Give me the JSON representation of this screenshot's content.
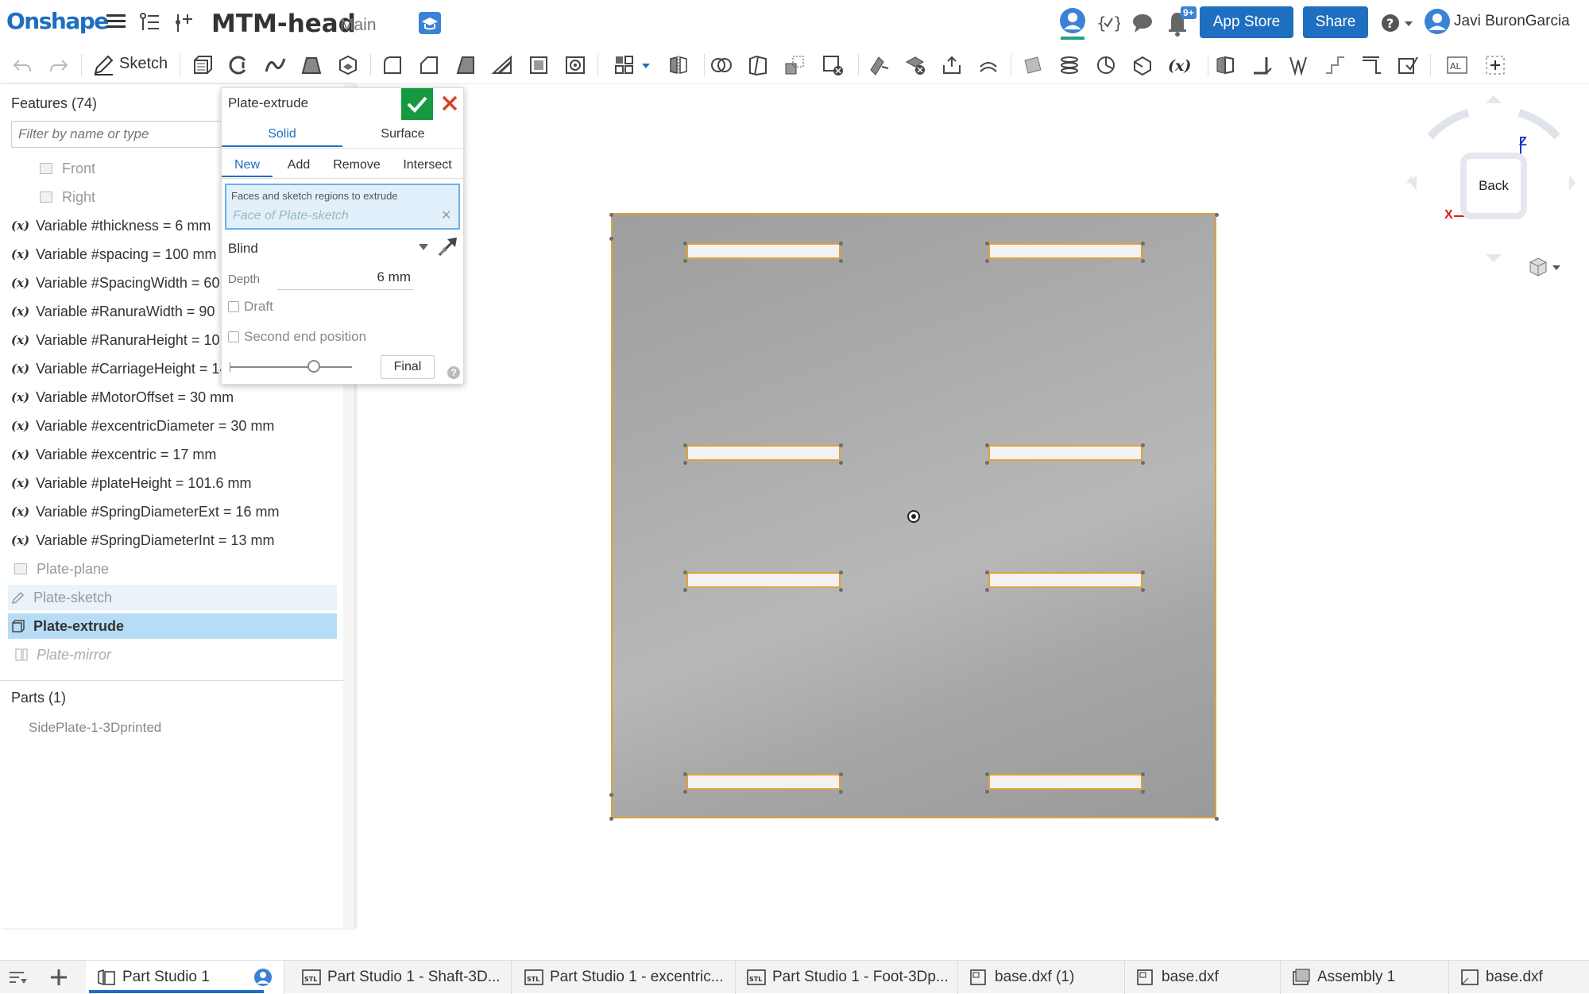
{
  "app": {
    "logo": "Onshape",
    "doc_title": "MTM-head",
    "branch": "Main",
    "app_store": "App Store",
    "share": "Share",
    "user_name": "Javi BuronGarcia",
    "notifications_badge": "9+"
  },
  "toolbar": {
    "sketch_label": "Sketch"
  },
  "features": {
    "header": "Features (74)",
    "filter_placeholder": "Filter by name or type",
    "items": [
      {
        "label": "Front",
        "type": "plane"
      },
      {
        "label": "Right",
        "type": "plane"
      },
      {
        "label": "Variable #thickness = 6 mm",
        "type": "variable"
      },
      {
        "label": "Variable #spacing = 100 mm",
        "type": "variable"
      },
      {
        "label": "Variable #SpacingWidth = 60",
        "type": "variable"
      },
      {
        "label": "Variable #RanuraWidth = 90",
        "type": "variable"
      },
      {
        "label": "Variable #RanuraHeight = 10",
        "type": "variable"
      },
      {
        "label": "Variable #CarriageHeight = 14",
        "type": "variable"
      },
      {
        "label": "Variable #MotorOffset = 30 mm",
        "type": "variable"
      },
      {
        "label": "Variable #excentricDiameter = 30 mm",
        "type": "variable"
      },
      {
        "label": "Variable #excentric = 17 mm",
        "type": "variable"
      },
      {
        "label": "Variable #plateHeight = 101.6 mm",
        "type": "variable"
      },
      {
        "label": "Variable #SpringDiameterExt = 16 mm",
        "type": "variable"
      },
      {
        "label": "Variable #SpringDiameterInt = 13 mm",
        "type": "variable"
      },
      {
        "label": "Plate-plane",
        "type": "plane"
      },
      {
        "label": "Plate-sketch",
        "type": "sketch"
      },
      {
        "label": "Plate-extrude",
        "type": "extrude"
      },
      {
        "label": "Plate-mirror",
        "type": "mirror"
      }
    ],
    "variable_icon": "(x)",
    "parts_header": "Parts (1)",
    "part_name": "SidePlate-1-3Dprinted"
  },
  "dialog": {
    "title": "Plate-extrude",
    "type_tabs": [
      "Solid",
      "Surface"
    ],
    "op_tabs": [
      "New",
      "Add",
      "Remove",
      "Intersect"
    ],
    "faces_label": "Faces and sketch regions to extrude",
    "faces_placeholder": "Face of Plate-sketch",
    "end_type": "Blind",
    "depth_label": "Depth",
    "depth_value": "6 mm",
    "draft_label": "Draft",
    "second_end_label": "Second end position",
    "final_label": "Final",
    "help": "?"
  },
  "viewcube": {
    "face": "Back",
    "z": "Z",
    "x": "X"
  },
  "tabs": [
    {
      "label": "Part Studio 1",
      "icon": "part-studio-icon"
    },
    {
      "label": "Part Studio 1 - Shaft-3D...",
      "icon": "stl-icon"
    },
    {
      "label": "Part Studio 1 - excentric...",
      "icon": "stl-icon"
    },
    {
      "label": "Part Studio 1 - Foot-3Dp...",
      "icon": "stl-icon"
    },
    {
      "label": "base.dxf (1)",
      "icon": "dxf-icon"
    },
    {
      "label": "base.dxf",
      "icon": "dxf-icon"
    },
    {
      "label": "Assembly 1",
      "icon": "assembly-icon"
    },
    {
      "label": "base.dxf",
      "icon": "drawing-icon"
    }
  ],
  "colors": {
    "accent": "#1f6fc0",
    "confirm": "#159a42",
    "cancel": "#d9402b",
    "edge_highlight": "#e0a23a",
    "selected_row": "#b7dcf5"
  }
}
